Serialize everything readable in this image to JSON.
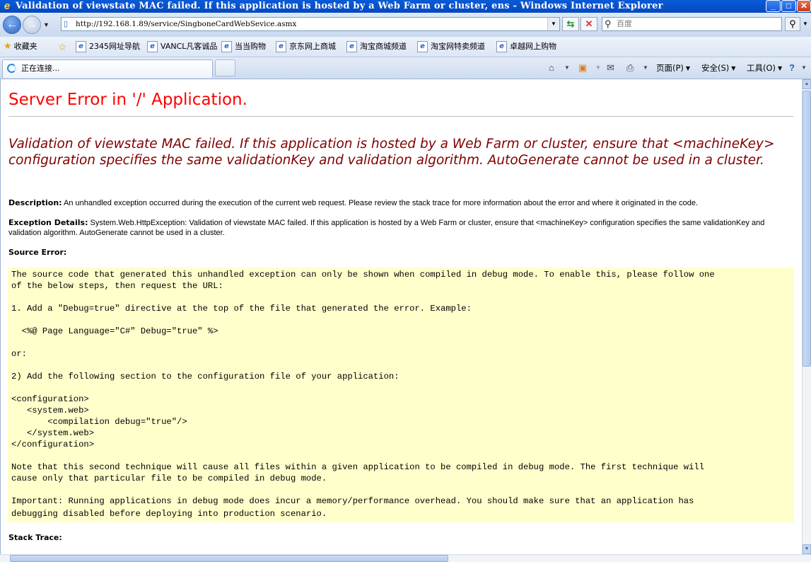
{
  "window": {
    "title": "Validation of viewstate MAC failed. If this application is hosted by a Web Farm or cluster, ens - Windows Internet Explorer",
    "buttons": {
      "minimize": "_",
      "maximize": "□",
      "close": "✕"
    }
  },
  "address_bar": {
    "url": "http://192.168.1.89/service/SingboneCardWebSevice.asmx",
    "search_placeholder": "百度"
  },
  "favorites_bar": {
    "favorites_label": "收藏夹",
    "links": [
      "2345网址导航",
      "VANCL凡客诚品",
      "当当购物",
      "京东网上商城",
      "淘宝商城频道",
      "淘宝网特卖频道",
      "卓越网上购物"
    ]
  },
  "tabs": {
    "active_label": "正在连接..."
  },
  "command_bar": {
    "page": "页面(P)",
    "safety": "安全(S)",
    "tools": "工具(O)"
  },
  "page": {
    "title": "Server Error in '/' Application.",
    "heading": "Validation of viewstate MAC failed. If this application is hosted by a Web Farm or cluster, ensure that <machineKey> configuration specifies the same validationKey and validation algorithm. AutoGenerate cannot be used in a cluster.",
    "description_label": "Description:",
    "description_text": "An unhandled exception occurred during the execution of the current web request. Please review the stack trace for more information about the error and where it originated in the code.",
    "exception_label": "Exception Details:",
    "exception_text": "System.Web.HttpException: Validation of viewstate MAC failed. If this application is hosted by a Web Farm or cluster, ensure that <machineKey> configuration specifies the same validationKey and validation algorithm. AutoGenerate cannot be used in a cluster.",
    "source_error_label": "Source Error:",
    "code_lines": [
      "The source code that generated this unhandled exception can only be shown when compiled in debug mode. To enable this, please follow one",
      "of the below steps, then request the URL:",
      "",
      "1. Add a \"Debug=true\" directive at the top of the file that generated the error. Example:",
      "",
      "  <%@ Page Language=\"C#\" Debug=\"true\" %>",
      "",
      "or:",
      "",
      "2) Add the following section to the configuration file of your application:",
      "",
      "<configuration>",
      "   <system.web>",
      "       <compilation debug=\"true\"/>",
      "   </system.web>",
      "</configuration>",
      "",
      "Note that this second technique will cause all files within a given application to be compiled in debug mode. The first technique will",
      "cause only that particular file to be compiled in debug mode.",
      "",
      "Important: Running applications in debug mode does incur a memory/performance overhead. You should make sure that an application has",
      "debugging disabled before deploying into production scenario."
    ],
    "stack_trace_label": "Stack Trace:"
  }
}
